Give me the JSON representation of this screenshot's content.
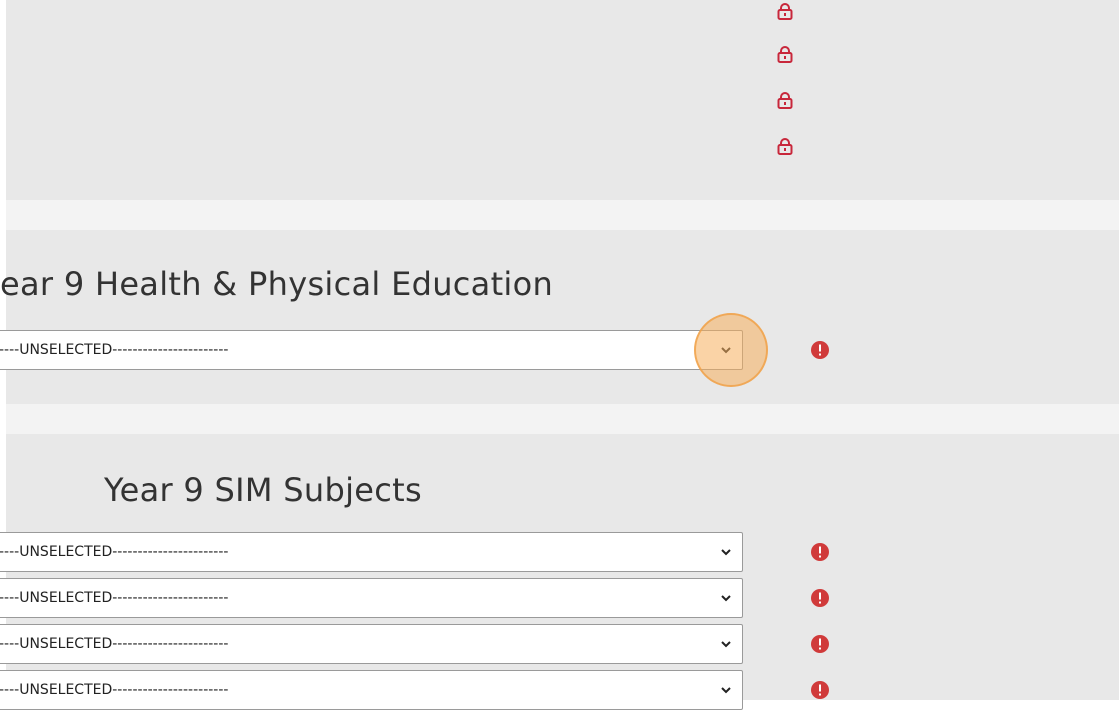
{
  "colors": {
    "lock": "#c8273b",
    "alert": "#d03a3a",
    "highlight": "#f5ae5c"
  },
  "top_section": {
    "lock_icons": [
      "lock-icon",
      "lock-icon",
      "lock-icon",
      "lock-icon"
    ]
  },
  "health_section": {
    "heading": "ear 9 Health & Physical Education",
    "dropdowns": [
      {
        "value": "----UNSELECTED-----------------------",
        "status_icon": "alert-icon"
      }
    ]
  },
  "sim_section": {
    "heading": "Year 9 SIM Subjects",
    "dropdowns": [
      {
        "value": "----UNSELECTED-----------------------",
        "status_icon": "alert-icon"
      },
      {
        "value": "----UNSELECTED-----------------------",
        "status_icon": "alert-icon"
      },
      {
        "value": "----UNSELECTED-----------------------",
        "status_icon": "alert-icon"
      },
      {
        "value": "----UNSELECTED-----------------------",
        "status_icon": "alert-icon"
      }
    ]
  }
}
